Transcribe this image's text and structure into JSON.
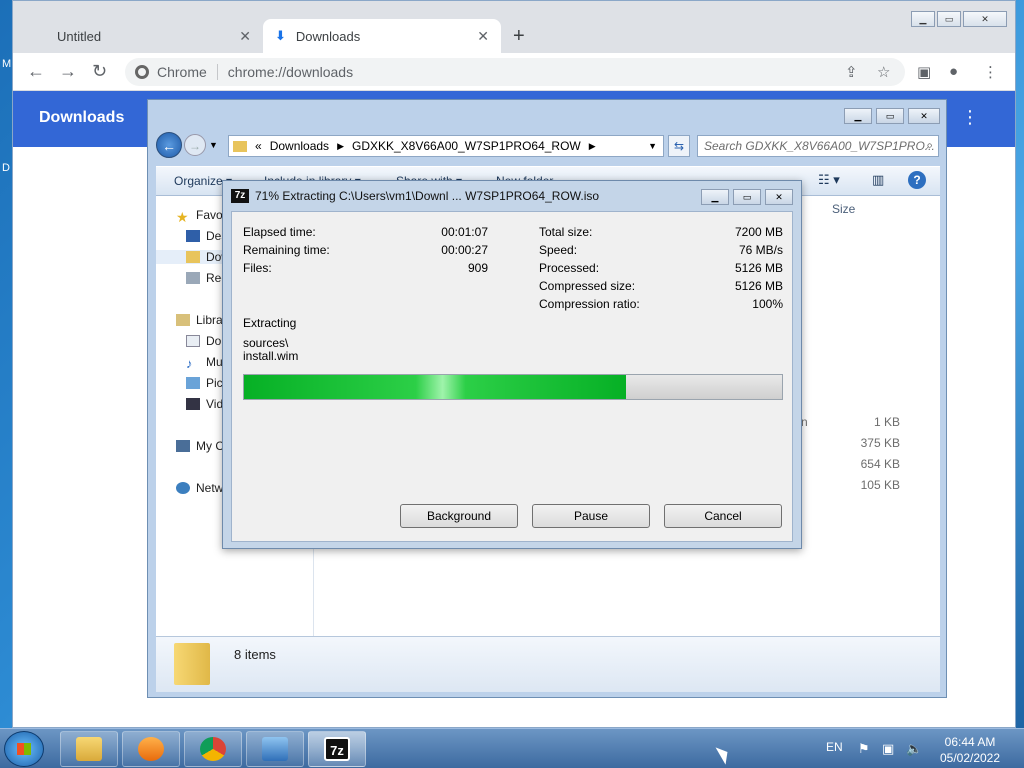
{
  "desktop": {
    "frag_m": "M",
    "frag_d": "D"
  },
  "chrome": {
    "tabs": [
      {
        "label": "Untitled"
      },
      {
        "label": "Downloads"
      }
    ],
    "url_chip": "Chrome",
    "url": "chrome://downloads",
    "page_title": "Downloads"
  },
  "explorer": {
    "breadcrumb": [
      "«",
      "Downloads",
      "GDXKK_X8V66A00_W7SP1PRO64_ROW"
    ],
    "search_placeholder": "Search GDXKK_X8V66A00_W7SP1PRO...",
    "toolbar": {
      "organize": "Organize ▾",
      "include": "Include in library ▾",
      "share": "Share with ▾",
      "new_folder": "New folder"
    },
    "nav": {
      "favorites": "Favo",
      "desktop": "Des",
      "downloads": "Dow",
      "recent": "Rec",
      "libraries": "Libra",
      "documents": "Do",
      "music": "Mu",
      "pictures": "Pic",
      "videos": "Vid",
      "computer": "My C",
      "network": "Netw"
    },
    "column_size": "Size",
    "files": [
      {
        "name": "n",
        "size": "1 KB"
      },
      {
        "name": "",
        "size": "375 KB"
      },
      {
        "name": "",
        "size": "654 KB"
      },
      {
        "name": "",
        "size": "105 KB"
      }
    ],
    "status": "8 items"
  },
  "sevenzip": {
    "title": "71% Extracting C:\\Users\\vm1\\Downl ... W7SP1PRO64_ROW.iso",
    "elapsed_label": "Elapsed time:",
    "elapsed_value": "00:01:07",
    "remaining_label": "Remaining time:",
    "remaining_value": "00:00:27",
    "files_label": "Files:",
    "files_value": "909",
    "total_label": "Total size:",
    "total_value": "7200 MB",
    "speed_label": "Speed:",
    "speed_value": "76 MB/s",
    "processed_label": "Processed:",
    "processed_value": "5126 MB",
    "compressed_label": "Compressed size:",
    "compressed_value": "5126 MB",
    "ratio_label": "Compression ratio:",
    "ratio_value": "100%",
    "operation": "Extracting",
    "current_path": "sources\\",
    "current_file": "install.wim",
    "progress_fraction": 0.71,
    "buttons": {
      "background": "Background",
      "pause": "Pause",
      "cancel": "Cancel"
    }
  },
  "taskbar": {
    "lang": "EN",
    "time": "06:44 AM",
    "date": "05/02/2022",
    "apps": [
      "explorer-icon",
      "media-player-icon",
      "chrome-icon",
      "control-panel-icon",
      "7zip-icon"
    ]
  }
}
